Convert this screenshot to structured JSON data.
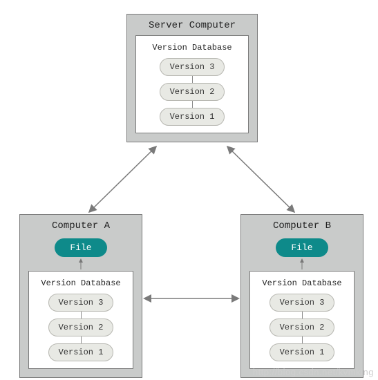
{
  "server": {
    "title": "Server Computer",
    "db_title": "Version Database",
    "versions": [
      "Version 3",
      "Version 2",
      "Version 1"
    ]
  },
  "computerA": {
    "title": "Computer A",
    "file_label": "File",
    "db_title": "Version Database",
    "versions": [
      "Version 3",
      "Version 2",
      "Version 1"
    ]
  },
  "computerB": {
    "title": "Computer B",
    "db_title": "Version Database",
    "file_label": "File",
    "versions": [
      "Version 3",
      "Version 2",
      "Version 1"
    ]
  },
  "watermark": "http://blog.csdn.net/kvmking",
  "colors": {
    "box_bg": "#c9cbca",
    "pill_bg": "#e8e9e4",
    "file_bg": "#0e8a8a"
  }
}
